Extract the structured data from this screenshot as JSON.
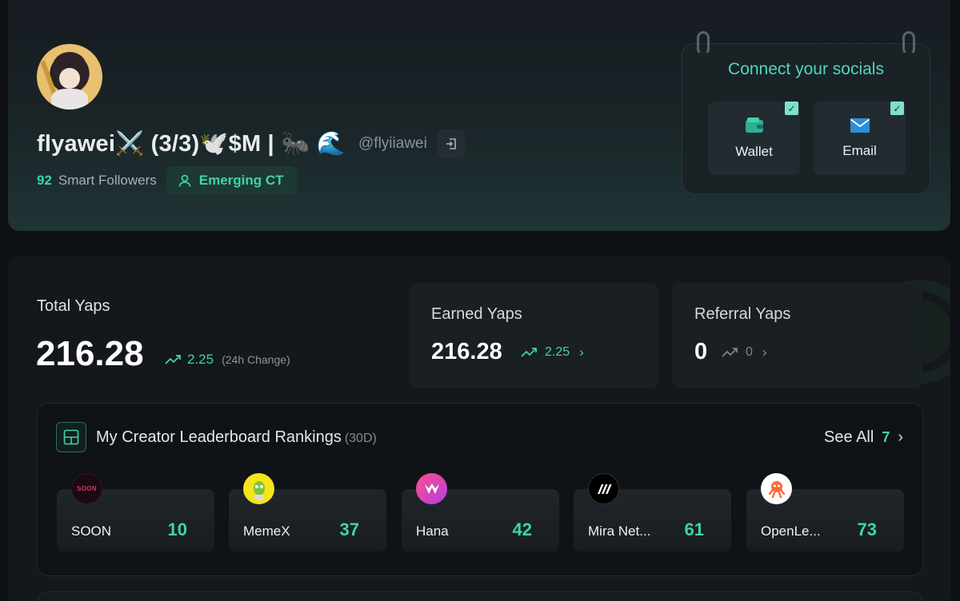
{
  "profile": {
    "display_name": "flyawei⚔️ (3/3)🕊️$M | 🐜 🌊",
    "handle": "@flyiiawei",
    "smart_followers_count": "92",
    "smart_followers_label": "Smart Followers",
    "badge_label": "Emerging CT"
  },
  "socials": {
    "title": "Connect your socials",
    "items": [
      {
        "label": "Wallet",
        "icon": "wallet-icon",
        "connected": true
      },
      {
        "label": "Email",
        "icon": "email-icon",
        "connected": true
      }
    ],
    "check_glyph": "✓"
  },
  "yaps": {
    "total_label": "Total Yaps",
    "total_value": "216.28",
    "total_change": "2.25",
    "change_note": "(24h Change)",
    "earned_label": "Earned Yaps",
    "earned_value": "216.28",
    "earned_change": "2.25",
    "referral_label": "Referral Yaps",
    "referral_value": "0",
    "referral_change": "0"
  },
  "rankings": {
    "title": "My Creator Leaderboard Rankings",
    "period": "(30D)",
    "see_all_label": "See All",
    "see_all_count": "7",
    "items": [
      {
        "name": "SOON",
        "rank": "10",
        "logo_text": "SOON"
      },
      {
        "name": "MemeX",
        "rank": "37"
      },
      {
        "name": "Hana",
        "rank": "42"
      },
      {
        "name": "Mira Net...",
        "rank": "61"
      },
      {
        "name": "OpenLe...",
        "rank": "73"
      }
    ]
  },
  "colors": {
    "accent": "#3fd3ac",
    "background": "#0d1014",
    "card": "#1a1f24"
  }
}
